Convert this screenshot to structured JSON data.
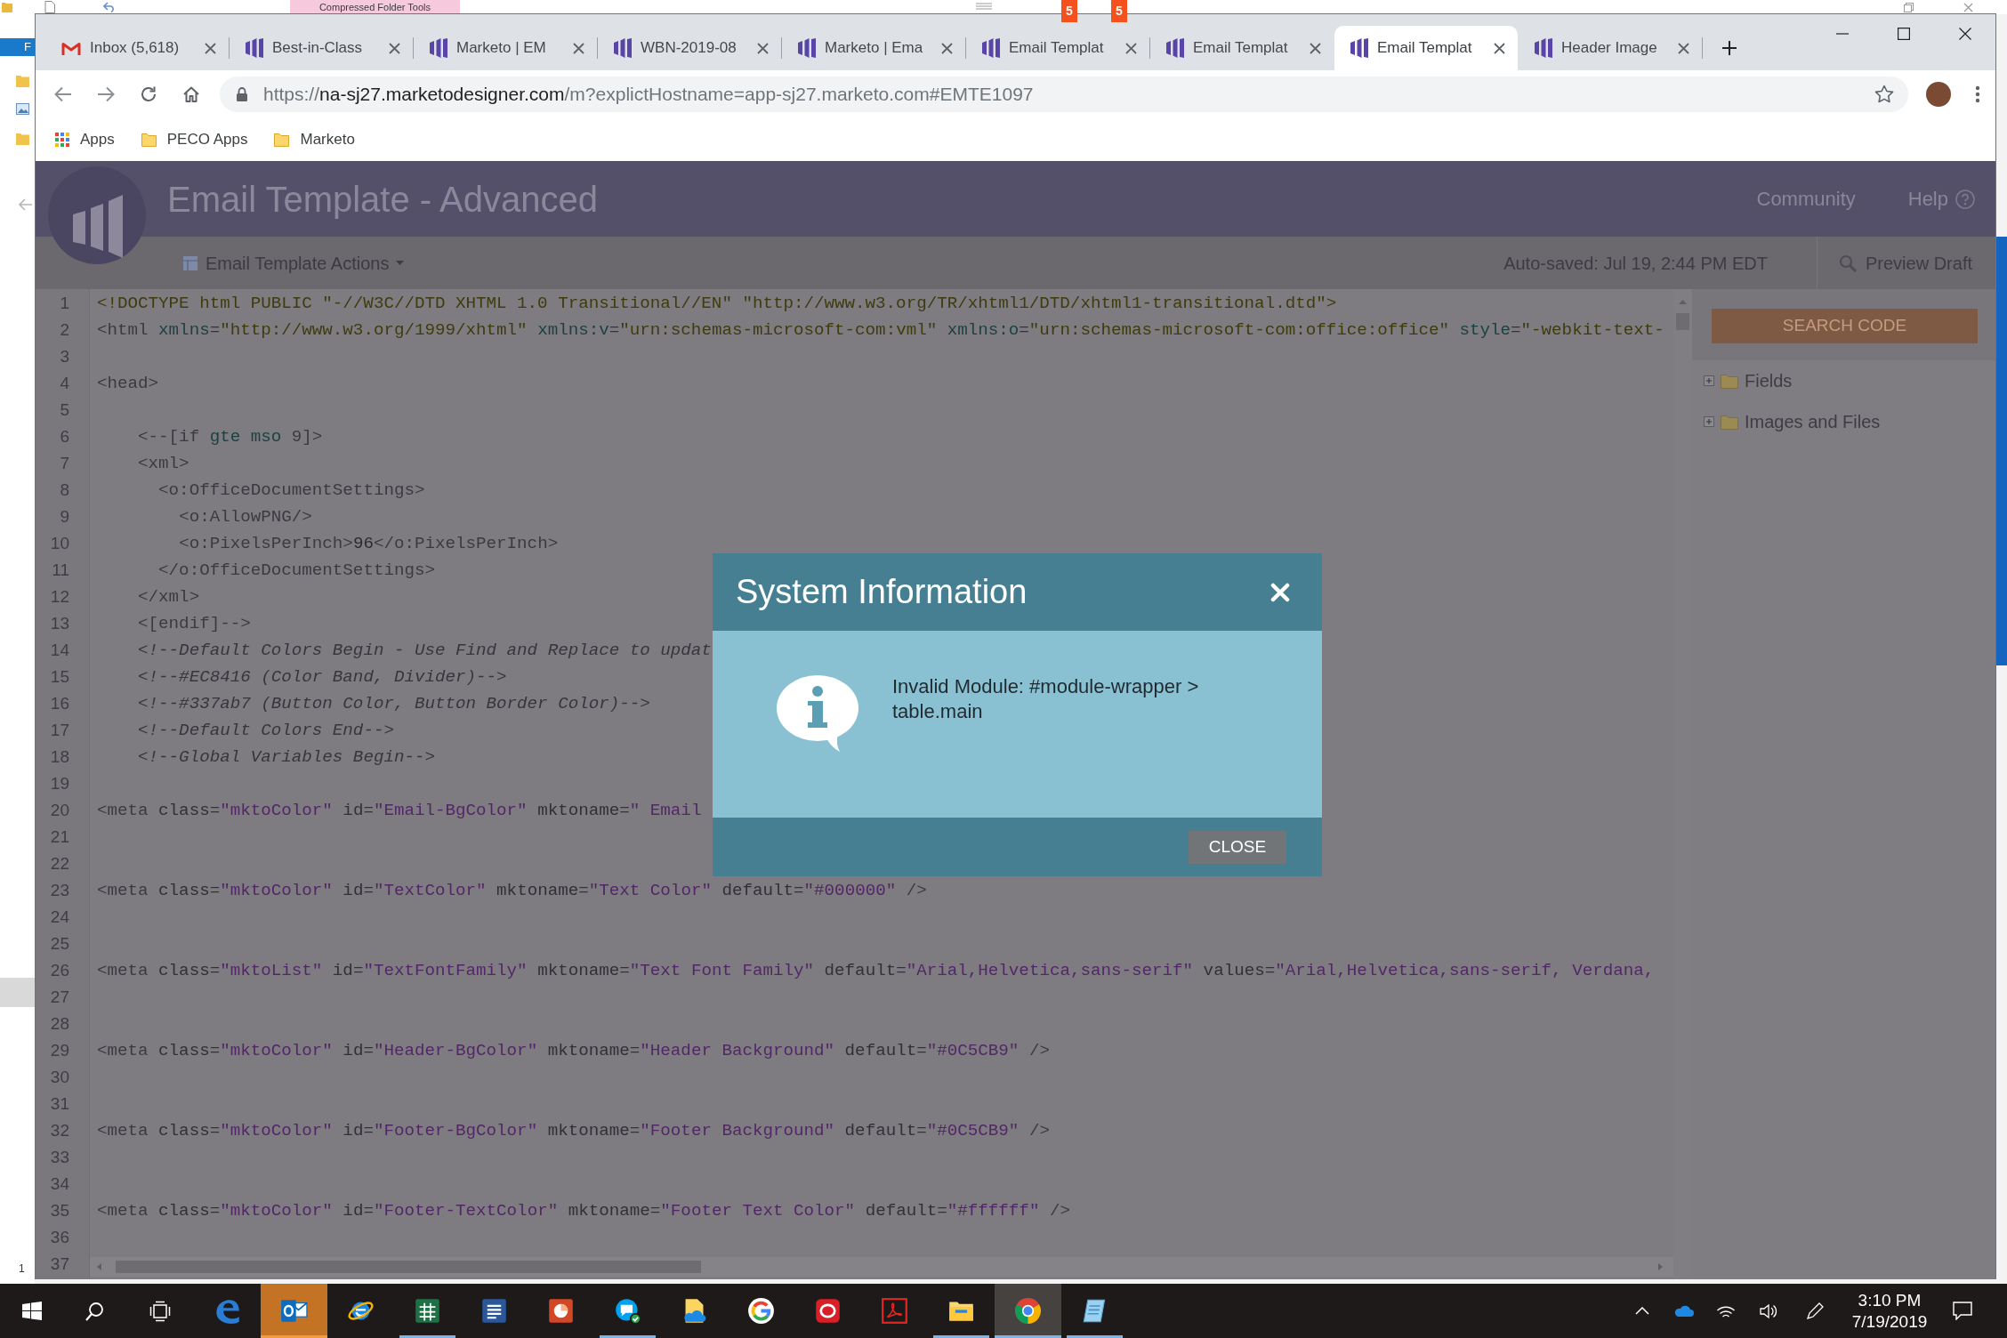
{
  "background": {
    "ribbon_tab": "Compressed Folder Tools",
    "file_tab": "F",
    "status_text": "1",
    "badges": [
      {
        "text": "5"
      },
      {
        "text": "5"
      }
    ]
  },
  "browser": {
    "tabs": [
      {
        "kind": "mletter",
        "label": "Inbox (5,618)",
        "selected": false
      },
      {
        "kind": "bars",
        "label": "Best-in-Class",
        "selected": false
      },
      {
        "kind": "bars",
        "label": "Marketo | EM",
        "selected": false
      },
      {
        "kind": "bars",
        "label": "WBN-2019-08",
        "selected": false
      },
      {
        "kind": "bars",
        "label": "Marketo | Ema",
        "selected": false
      },
      {
        "kind": "bars",
        "label": "Email Templat",
        "selected": false
      },
      {
        "kind": "bars",
        "label": "Email Templat",
        "selected": false
      },
      {
        "kind": "bars",
        "label": "Email Templat",
        "selected": true
      },
      {
        "kind": "bars",
        "label": "Header Image",
        "selected": false
      }
    ],
    "url": {
      "scheme": "https://",
      "host": "na-sj27.marketodesigner.com",
      "path": "/m?explictHostname=app-sj27.marketo.com#EMTE1097"
    },
    "bookmarks": [
      {
        "kind": "grid",
        "label": "Apps"
      },
      {
        "kind": "folder",
        "label": "PECO Apps"
      },
      {
        "kind": "folder",
        "label": "Marketo"
      }
    ]
  },
  "app": {
    "title": "Email Template - Advanced",
    "nav": [
      {
        "kind": "link",
        "label": "Community"
      },
      {
        "kind": "help",
        "label": "Help"
      }
    ],
    "actions_menu": "Email Template Actions",
    "autosave": "Auto-saved: Jul 19, 2:44 PM EDT",
    "preview": "Preview Draft"
  },
  "editor": {
    "lines": [
      {
        "number": "1",
        "segments": [
          {
            "kind": "doctype",
            "text": "<!DOCTYPE html PUBLIC \"-//W3C//DTD XHTML 1.0 Transitional//EN\" \"http://www.w3.org/TR/xhtml1/DTD/xhtml1-transitional.dtd\">"
          }
        ]
      },
      {
        "number": "2",
        "segments": [
          {
            "kind": "tag",
            "text": "<html "
          },
          {
            "kind": "attr",
            "text": "xmlns"
          },
          {
            "kind": "punct",
            "text": "="
          },
          {
            "kind": "value",
            "text": "\"http://www.w3.org/1999/xhtml\""
          },
          {
            "kind": "attr",
            "text": " xmlns:v"
          },
          {
            "kind": "punct",
            "text": "="
          },
          {
            "kind": "value",
            "text": "\"urn:schemas-microsoft-com:vml\""
          },
          {
            "kind": "attr",
            "text": " xmlns:o"
          },
          {
            "kind": "punct",
            "text": "="
          },
          {
            "kind": "value",
            "text": "\"urn:schemas-microsoft-com:office:office\""
          },
          {
            "kind": "attr",
            "text": " style"
          },
          {
            "kind": "punct",
            "text": "="
          },
          {
            "kind": "value",
            "text": "\"-webkit-text-"
          }
        ]
      },
      {
        "number": "3"
      },
      {
        "number": "4",
        "segments": [
          {
            "kind": "tag",
            "text": "<head>"
          }
        ]
      },
      {
        "number": "5"
      },
      {
        "number": "6",
        "segments": [
          {
            "kind": "tag",
            "text": "    <--[if "
          },
          {
            "kind": "keyword",
            "text": "gte mso"
          },
          {
            "kind": "tag",
            "text": " 9]>"
          }
        ]
      },
      {
        "number": "7",
        "segments": [
          {
            "kind": "tag",
            "text": "    <xml>"
          }
        ]
      },
      {
        "number": "8",
        "segments": [
          {
            "kind": "tag",
            "text": "      <o:OfficeDocumentSettings>"
          }
        ]
      },
      {
        "number": "9",
        "segments": [
          {
            "kind": "tag",
            "text": "        <o:AllowPNG/>"
          }
        ]
      },
      {
        "number": "10",
        "segments": [
          {
            "kind": "tag",
            "text": "        <o:PixelsPerInch>"
          },
          {
            "kind": "text",
            "text": "96"
          },
          {
            "kind": "tag",
            "text": "</o:PixelsPerInch>"
          }
        ]
      },
      {
        "number": "11",
        "segments": [
          {
            "kind": "tag",
            "text": "      </o:OfficeDocumentSettings>"
          }
        ]
      },
      {
        "number": "12",
        "segments": [
          {
            "kind": "tag",
            "text": "    </xml>"
          }
        ]
      },
      {
        "number": "13",
        "segments": [
          {
            "kind": "tag",
            "text": "    <[endif]-->"
          }
        ]
      },
      {
        "number": "14",
        "segments": [
          {
            "kind": "comment",
            "text": "    <!--Default Colors Begin - Use Find and Replace to updat"
          }
        ]
      },
      {
        "number": "15",
        "segments": [
          {
            "kind": "comment",
            "text": "    <!--#EC8416 (Color Band, Divider)-->"
          }
        ]
      },
      {
        "number": "16",
        "segments": [
          {
            "kind": "comment",
            "text": "    <!--#337ab7 (Button Color, Button Border Color)-->"
          }
        ]
      },
      {
        "number": "17",
        "segments": [
          {
            "kind": "comment",
            "text": "    <!--Default Colors End-->"
          }
        ]
      },
      {
        "number": "18",
        "segments": [
          {
            "kind": "comment",
            "text": "    <!--Global Variables Begin-->"
          }
        ]
      },
      {
        "number": "19"
      },
      {
        "number": "20",
        "segments": [
          {
            "kind": "tag",
            "text": "<meta "
          },
          {
            "kind": "mattr",
            "text": "class"
          },
          {
            "kind": "punct",
            "text": "="
          },
          {
            "kind": "mvalue",
            "text": "\"mktoColor\""
          },
          {
            "kind": "mattr",
            "text": " id"
          },
          {
            "kind": "punct",
            "text": "="
          },
          {
            "kind": "mvalue",
            "text": "\"Email-BgColor\""
          },
          {
            "kind": "mattr",
            "text": " mktoname"
          },
          {
            "kind": "punct",
            "text": "="
          },
          {
            "kind": "mvalue",
            "text": "\" Email"
          }
        ]
      },
      {
        "number": "21"
      },
      {
        "number": "22"
      },
      {
        "number": "23",
        "segments": [
          {
            "kind": "tag",
            "text": "<meta "
          },
          {
            "kind": "mattr",
            "text": "class"
          },
          {
            "kind": "punct",
            "text": "="
          },
          {
            "kind": "mvalue",
            "text": "\"mktoColor\""
          },
          {
            "kind": "mattr",
            "text": " id"
          },
          {
            "kind": "punct",
            "text": "="
          },
          {
            "kind": "mvalue",
            "text": "\"TextColor\""
          },
          {
            "kind": "mattr",
            "text": " mktoname"
          },
          {
            "kind": "punct",
            "text": "="
          },
          {
            "kind": "mvalue",
            "text": "\"Text Color\""
          },
          {
            "kind": "mattr",
            "text": " default"
          },
          {
            "kind": "punct",
            "text": "="
          },
          {
            "kind": "mvalue",
            "text": "\"#000000\""
          },
          {
            "kind": "tag",
            "text": " />"
          }
        ]
      },
      {
        "number": "24"
      },
      {
        "number": "25"
      },
      {
        "number": "26",
        "segments": [
          {
            "kind": "tag",
            "text": "<meta "
          },
          {
            "kind": "mattr",
            "text": "class"
          },
          {
            "kind": "punct",
            "text": "="
          },
          {
            "kind": "mvalue",
            "text": "\"mktoList\""
          },
          {
            "kind": "mattr",
            "text": " id"
          },
          {
            "kind": "punct",
            "text": "="
          },
          {
            "kind": "mvalue",
            "text": "\"TextFontFamily\""
          },
          {
            "kind": "mattr",
            "text": " mktoname"
          },
          {
            "kind": "punct",
            "text": "="
          },
          {
            "kind": "mvalue",
            "text": "\"Text Font Family\""
          },
          {
            "kind": "mattr",
            "text": " default"
          },
          {
            "kind": "punct",
            "text": "="
          },
          {
            "kind": "mvalue",
            "text": "\"Arial,Helvetica,sans-serif\""
          },
          {
            "kind": "mattr",
            "text": " values"
          },
          {
            "kind": "punct",
            "text": "="
          },
          {
            "kind": "mvalue",
            "text": "\"Arial,Helvetica,sans-serif, Verdana,"
          }
        ]
      },
      {
        "number": "27"
      },
      {
        "number": "28"
      },
      {
        "number": "29",
        "segments": [
          {
            "kind": "tag",
            "text": "<meta "
          },
          {
            "kind": "mattr",
            "text": "class"
          },
          {
            "kind": "punct",
            "text": "="
          },
          {
            "kind": "mvalue",
            "text": "\"mktoColor\""
          },
          {
            "kind": "mattr",
            "text": " id"
          },
          {
            "kind": "punct",
            "text": "="
          },
          {
            "kind": "mvalue",
            "text": "\"Header-BgColor\""
          },
          {
            "kind": "mattr",
            "text": " mktoname"
          },
          {
            "kind": "punct",
            "text": "="
          },
          {
            "kind": "mvalue",
            "text": "\"Header Background\""
          },
          {
            "kind": "mattr",
            "text": " default"
          },
          {
            "kind": "punct",
            "text": "="
          },
          {
            "kind": "mvalue",
            "text": "\"#0C5CB9\""
          },
          {
            "kind": "tag",
            "text": " />"
          }
        ]
      },
      {
        "number": "30"
      },
      {
        "number": "31"
      },
      {
        "number": "32",
        "segments": [
          {
            "kind": "tag",
            "text": "<meta "
          },
          {
            "kind": "mattr",
            "text": "class"
          },
          {
            "kind": "punct",
            "text": "="
          },
          {
            "kind": "mvalue",
            "text": "\"mktoColor\""
          },
          {
            "kind": "mattr",
            "text": " id"
          },
          {
            "kind": "punct",
            "text": "="
          },
          {
            "kind": "mvalue",
            "text": "\"Footer-BgColor\""
          },
          {
            "kind": "mattr",
            "text": " mktoname"
          },
          {
            "kind": "punct",
            "text": "="
          },
          {
            "kind": "mvalue",
            "text": "\"Footer Background\""
          },
          {
            "kind": "mattr",
            "text": " default"
          },
          {
            "kind": "punct",
            "text": "="
          },
          {
            "kind": "mvalue",
            "text": "\"#0C5CB9\""
          },
          {
            "kind": "tag",
            "text": " />"
          }
        ]
      },
      {
        "number": "33"
      },
      {
        "number": "34"
      },
      {
        "number": "35",
        "segments": [
          {
            "kind": "tag",
            "text": "<meta "
          },
          {
            "kind": "mattr",
            "text": "class"
          },
          {
            "kind": "punct",
            "text": "="
          },
          {
            "kind": "mvalue",
            "text": "\"mktoColor\""
          },
          {
            "kind": "mattr",
            "text": " id"
          },
          {
            "kind": "punct",
            "text": "="
          },
          {
            "kind": "mvalue",
            "text": "\"Footer-TextColor\""
          },
          {
            "kind": "mattr",
            "text": " mktoname"
          },
          {
            "kind": "punct",
            "text": "="
          },
          {
            "kind": "mvalue",
            "text": "\"Footer Text Color\""
          },
          {
            "kind": "mattr",
            "text": " default"
          },
          {
            "kind": "punct",
            "text": "="
          },
          {
            "kind": "mvalue",
            "text": "\"#ffffff\""
          },
          {
            "kind": "tag",
            "text": " />"
          }
        ]
      },
      {
        "number": "36"
      },
      {
        "number": "37"
      }
    ]
  },
  "sidebar": {
    "search_button": "SEARCH CODE",
    "tree": [
      {
        "label": "Fields",
        "expanded": false
      },
      {
        "label": "Images and Files",
        "expanded": false
      }
    ]
  },
  "dialog": {
    "title": "System Information",
    "message": "Invalid Module: #module-wrapper > table.main",
    "button": "CLOSE"
  },
  "taskbar": {
    "apps": [
      {
        "kind": "elogo",
        "running": false,
        "attention": false,
        "selected": false
      },
      {
        "kind": "mail",
        "running": true,
        "attention": true,
        "selected": false
      },
      {
        "kind": "ering",
        "running": false,
        "attention": false,
        "selected": false
      },
      {
        "kind": "sheet",
        "running": true,
        "attention": false,
        "selected": false
      },
      {
        "kind": "document",
        "running": false,
        "attention": false,
        "selected": false
      },
      {
        "kind": "slides",
        "running": false,
        "attention": false,
        "selected": false
      },
      {
        "kind": "chat",
        "running": true,
        "attention": false,
        "selected": false
      },
      {
        "kind": "files",
        "running": false,
        "attention": false,
        "selected": false
      },
      {
        "kind": "gletter",
        "running": false,
        "attention": false,
        "selected": false
      },
      {
        "kind": "swirl",
        "running": false,
        "attention": false,
        "selected": false
      },
      {
        "kind": "pdf",
        "running": false,
        "attention": false,
        "selected": false
      },
      {
        "kind": "folder",
        "running": true,
        "attention": false,
        "selected": false
      },
      {
        "kind": "wheel",
        "running": true,
        "attention": false,
        "selected": true
      },
      {
        "kind": "notes",
        "running": true,
        "attention": false,
        "selected": false
      }
    ],
    "time": "3:10 PM",
    "date": "7/19/2019"
  }
}
